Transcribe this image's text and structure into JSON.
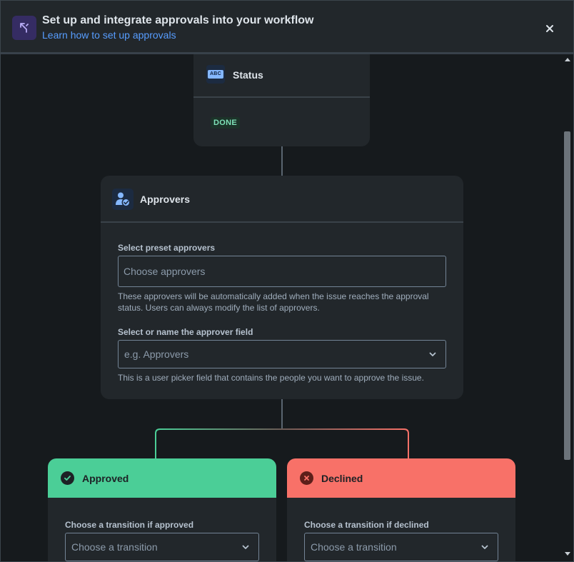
{
  "header": {
    "title": "Set up and integrate approvals into your workflow",
    "link": "Learn how to set up approvals",
    "icon": "branch-icon",
    "close_icon": "close-icon"
  },
  "status_card": {
    "title": "Status",
    "icon_text": "ABC",
    "lozenge": "DONE"
  },
  "approvers_card": {
    "title": "Approvers",
    "preset_label": "Select preset approvers",
    "preset_placeholder": "Choose approvers",
    "preset_helper": "These approvers will be automatically added when the issue reaches the approval status. Users can always modify the list of approvers.",
    "field_label": "Select or name the approver field",
    "field_placeholder": "e.g. Approvers",
    "field_helper": "This is a user picker field that contains the people you want to approve the issue."
  },
  "approved_card": {
    "title": "Approved",
    "label": "Choose a transition if approved",
    "placeholder": "Choose a transition"
  },
  "declined_card": {
    "title": "Declined",
    "label": "Choose a transition if declined",
    "placeholder": "Choose a transition"
  },
  "colors": {
    "approved": "#4bce97",
    "declined": "#f87168",
    "link": "#579dff",
    "background": "#161a1d",
    "card": "#22272b"
  }
}
